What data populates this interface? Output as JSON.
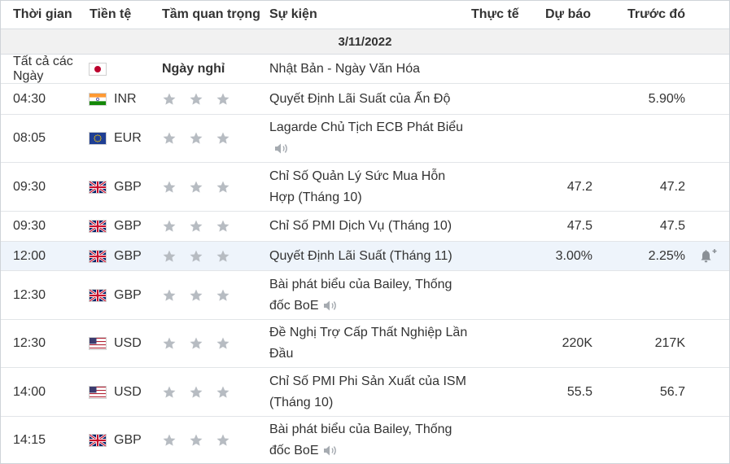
{
  "headers": {
    "time": "Thời gian",
    "currency": "Tiền tệ",
    "importance": "Tầm quan trọng",
    "event": "Sự kiện",
    "actual": "Thực tế",
    "forecast": "Dự báo",
    "previous": "Trước đó"
  },
  "date": "3/11/2022",
  "holiday": {
    "time": "Tất cả các Ngày",
    "flag": "japan-flag-icon",
    "label": "Ngày nghỉ",
    "event": "Nhật Bản - Ngày Văn Hóa"
  },
  "colors": {
    "star": "#b7bcc2",
    "border": "#e2e5e8",
    "highlight": "#eef4fb",
    "date_bg": "#f1f1f1"
  },
  "events": [
    {
      "time": "04:30",
      "currency": "INR",
      "flag": "india-flag-icon",
      "event": "Quyết Định Lãi Suất của Ấn Độ",
      "actual": "",
      "forecast": "",
      "previous": "5.90%",
      "speech": false
    },
    {
      "time": "08:05",
      "currency": "EUR",
      "flag": "eu-flag-icon",
      "event": "Lagarde Chủ Tịch ECB Phát Biểu",
      "actual": "",
      "forecast": "",
      "previous": "",
      "speech": true
    },
    {
      "time": "09:30",
      "currency": "GBP",
      "flag": "uk-flag-icon",
      "event": "Chỉ Số Quản Lý Sức Mua Hỗn Hợp (Tháng 10)",
      "actual": "",
      "forecast": "47.2",
      "previous": "47.2",
      "speech": false
    },
    {
      "time": "09:30",
      "currency": "GBP",
      "flag": "uk-flag-icon",
      "event": "Chỉ Số PMI Dịch Vụ (Tháng 10)",
      "actual": "",
      "forecast": "47.5",
      "previous": "47.5",
      "speech": false
    },
    {
      "time": "12:00",
      "currency": "GBP",
      "flag": "uk-flag-icon",
      "event": "Quyết Định Lãi Suất (Tháng 11)",
      "actual": "",
      "forecast": "3.00%",
      "previous": "2.25%",
      "speech": false,
      "highlight": true,
      "alert": true
    },
    {
      "time": "12:30",
      "currency": "GBP",
      "flag": "uk-flag-icon",
      "event": "Bài phát biểu của Bailey, Thống đốc BoE",
      "actual": "",
      "forecast": "",
      "previous": "",
      "speech": true
    },
    {
      "time": "12:30",
      "currency": "USD",
      "flag": "us-flag-icon",
      "event": "Đề Nghị Trợ Cấp Thất Nghiệp Lần Đầu",
      "actual": "",
      "forecast": "220K",
      "previous": "217K",
      "speech": false
    },
    {
      "time": "14:00",
      "currency": "USD",
      "flag": "us-flag-icon",
      "event": "Chỉ Số PMI Phi Sản Xuất của ISM (Tháng 10)",
      "actual": "",
      "forecast": "55.5",
      "previous": "56.7",
      "speech": false
    },
    {
      "time": "14:15",
      "currency": "GBP",
      "flag": "uk-flag-icon",
      "event": "Bài phát biểu của Bailey, Thống đốc BoE",
      "actual": "",
      "forecast": "",
      "previous": "",
      "speech": true
    }
  ]
}
